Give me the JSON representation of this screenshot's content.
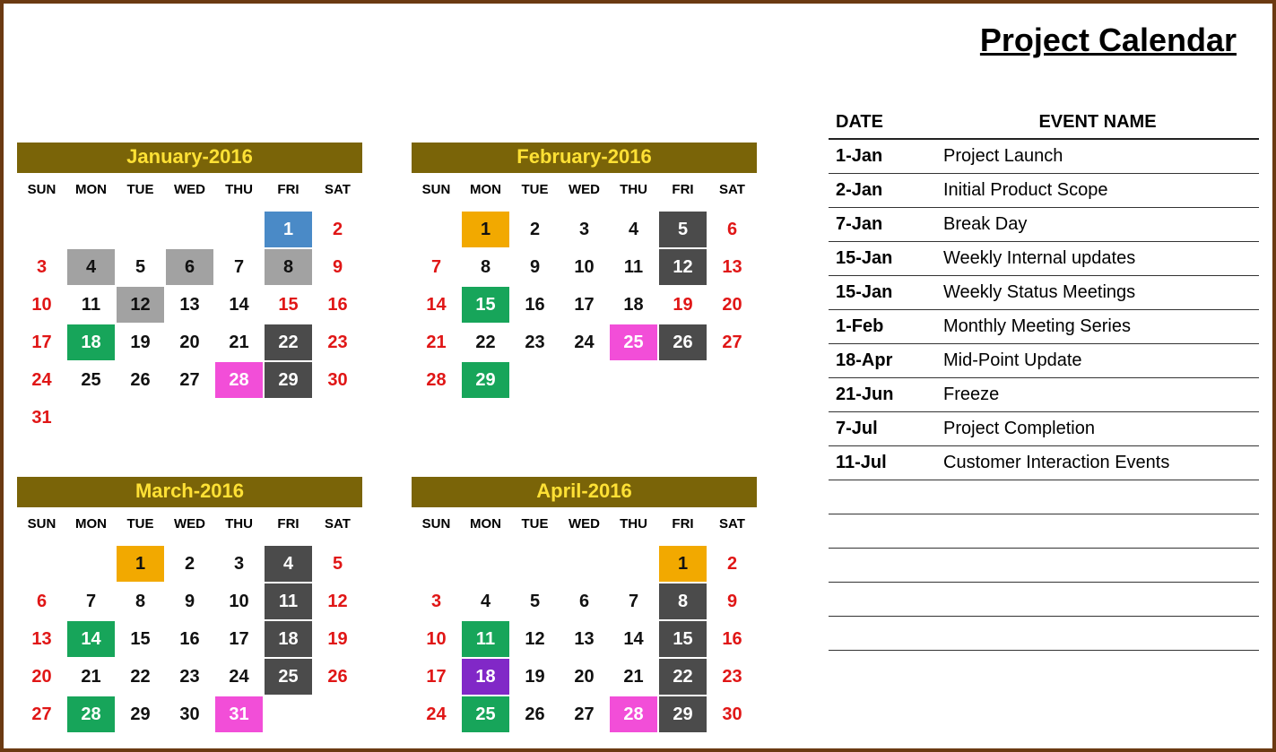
{
  "title": "Project Calendar",
  "dow": [
    "SUN",
    "MON",
    "TUE",
    "WED",
    "THU",
    "FRI",
    "SAT"
  ],
  "months": [
    {
      "title": "January-2016",
      "lead": 5,
      "days": [
        {
          "n": 1,
          "c": "hl-blue"
        },
        {
          "n": 2,
          "c": "weekend"
        },
        {
          "n": 3,
          "c": "weekend"
        },
        {
          "n": 4,
          "c": "hl-grey"
        },
        {
          "n": 5,
          "c": "normal"
        },
        {
          "n": 6,
          "c": "hl-grey"
        },
        {
          "n": 7,
          "c": "normal"
        },
        {
          "n": 8,
          "c": "hl-grey"
        },
        {
          "n": 9,
          "c": "weekend"
        },
        {
          "n": 10,
          "c": "weekend"
        },
        {
          "n": 11,
          "c": "normal"
        },
        {
          "n": 12,
          "c": "hl-grey"
        },
        {
          "n": 13,
          "c": "normal"
        },
        {
          "n": 14,
          "c": "normal"
        },
        {
          "n": 15,
          "c": "hl-redfriday"
        },
        {
          "n": 16,
          "c": "weekend"
        },
        {
          "n": 17,
          "c": "weekend"
        },
        {
          "n": 18,
          "c": "hl-green"
        },
        {
          "n": 19,
          "c": "normal"
        },
        {
          "n": 20,
          "c": "normal"
        },
        {
          "n": 21,
          "c": "normal"
        },
        {
          "n": 22,
          "c": "hl-dark"
        },
        {
          "n": 23,
          "c": "weekend"
        },
        {
          "n": 24,
          "c": "weekend"
        },
        {
          "n": 25,
          "c": "normal"
        },
        {
          "n": 26,
          "c": "normal"
        },
        {
          "n": 27,
          "c": "normal"
        },
        {
          "n": 28,
          "c": "hl-pink"
        },
        {
          "n": 29,
          "c": "hl-dark"
        },
        {
          "n": 30,
          "c": "weekend"
        },
        {
          "n": 31,
          "c": "weekend"
        }
      ]
    },
    {
      "title": "February-2016",
      "lead": 1,
      "days": [
        {
          "n": 1,
          "c": "hl-orange"
        },
        {
          "n": 2,
          "c": "normal"
        },
        {
          "n": 3,
          "c": "normal"
        },
        {
          "n": 4,
          "c": "normal"
        },
        {
          "n": 5,
          "c": "hl-dark"
        },
        {
          "n": 6,
          "c": "weekend"
        },
        {
          "n": 7,
          "c": "weekend"
        },
        {
          "n": 8,
          "c": "normal"
        },
        {
          "n": 9,
          "c": "normal"
        },
        {
          "n": 10,
          "c": "normal"
        },
        {
          "n": 11,
          "c": "normal"
        },
        {
          "n": 12,
          "c": "hl-dark"
        },
        {
          "n": 13,
          "c": "weekend"
        },
        {
          "n": 14,
          "c": "weekend"
        },
        {
          "n": 15,
          "c": "hl-green"
        },
        {
          "n": 16,
          "c": "normal"
        },
        {
          "n": 17,
          "c": "normal"
        },
        {
          "n": 18,
          "c": "normal"
        },
        {
          "n": 19,
          "c": "hl-redfriday"
        },
        {
          "n": 20,
          "c": "weekend"
        },
        {
          "n": 21,
          "c": "weekend"
        },
        {
          "n": 22,
          "c": "normal"
        },
        {
          "n": 23,
          "c": "normal"
        },
        {
          "n": 24,
          "c": "normal"
        },
        {
          "n": 25,
          "c": "hl-pink"
        },
        {
          "n": 26,
          "c": "hl-dark"
        },
        {
          "n": 27,
          "c": "weekend"
        },
        {
          "n": 28,
          "c": "weekend"
        },
        {
          "n": 29,
          "c": "hl-green"
        }
      ]
    },
    {
      "title": "March-2016",
      "lead": 2,
      "days": [
        {
          "n": 1,
          "c": "hl-orange"
        },
        {
          "n": 2,
          "c": "normal"
        },
        {
          "n": 3,
          "c": "normal"
        },
        {
          "n": 4,
          "c": "hl-dark"
        },
        {
          "n": 5,
          "c": "weekend"
        },
        {
          "n": 6,
          "c": "weekend"
        },
        {
          "n": 7,
          "c": "normal"
        },
        {
          "n": 8,
          "c": "normal"
        },
        {
          "n": 9,
          "c": "normal"
        },
        {
          "n": 10,
          "c": "normal"
        },
        {
          "n": 11,
          "c": "hl-dark"
        },
        {
          "n": 12,
          "c": "weekend"
        },
        {
          "n": 13,
          "c": "weekend"
        },
        {
          "n": 14,
          "c": "hl-green"
        },
        {
          "n": 15,
          "c": "normal"
        },
        {
          "n": 16,
          "c": "normal"
        },
        {
          "n": 17,
          "c": "normal"
        },
        {
          "n": 18,
          "c": "hl-dark"
        },
        {
          "n": 19,
          "c": "weekend"
        },
        {
          "n": 20,
          "c": "weekend"
        },
        {
          "n": 21,
          "c": "normal"
        },
        {
          "n": 22,
          "c": "normal"
        },
        {
          "n": 23,
          "c": "normal"
        },
        {
          "n": 24,
          "c": "normal"
        },
        {
          "n": 25,
          "c": "hl-dark"
        },
        {
          "n": 26,
          "c": "weekend"
        },
        {
          "n": 27,
          "c": "weekend"
        },
        {
          "n": 28,
          "c": "hl-green"
        },
        {
          "n": 29,
          "c": "normal"
        },
        {
          "n": 30,
          "c": "normal"
        },
        {
          "n": 31,
          "c": "hl-pink"
        }
      ]
    },
    {
      "title": "April-2016",
      "lead": 5,
      "days": [
        {
          "n": 1,
          "c": "hl-orange"
        },
        {
          "n": 2,
          "c": "weekend"
        },
        {
          "n": 3,
          "c": "weekend"
        },
        {
          "n": 4,
          "c": "normal"
        },
        {
          "n": 5,
          "c": "normal"
        },
        {
          "n": 6,
          "c": "normal"
        },
        {
          "n": 7,
          "c": "normal"
        },
        {
          "n": 8,
          "c": "hl-dark"
        },
        {
          "n": 9,
          "c": "weekend"
        },
        {
          "n": 10,
          "c": "weekend"
        },
        {
          "n": 11,
          "c": "hl-green"
        },
        {
          "n": 12,
          "c": "normal"
        },
        {
          "n": 13,
          "c": "normal"
        },
        {
          "n": 14,
          "c": "normal"
        },
        {
          "n": 15,
          "c": "hl-dark"
        },
        {
          "n": 16,
          "c": "weekend"
        },
        {
          "n": 17,
          "c": "weekend"
        },
        {
          "n": 18,
          "c": "hl-purple"
        },
        {
          "n": 19,
          "c": "normal"
        },
        {
          "n": 20,
          "c": "normal"
        },
        {
          "n": 21,
          "c": "normal"
        },
        {
          "n": 22,
          "c": "hl-dark"
        },
        {
          "n": 23,
          "c": "weekend"
        },
        {
          "n": 24,
          "c": "weekend"
        },
        {
          "n": 25,
          "c": "hl-green"
        },
        {
          "n": 26,
          "c": "normal"
        },
        {
          "n": 27,
          "c": "normal"
        },
        {
          "n": 28,
          "c": "hl-pink"
        },
        {
          "n": 29,
          "c": "hl-dark"
        },
        {
          "n": 30,
          "c": "weekend"
        }
      ]
    }
  ],
  "events_header": {
    "date": "DATE",
    "name": "EVENT NAME"
  },
  "events": [
    {
      "date": "1-Jan",
      "name": "Project Launch"
    },
    {
      "date": "2-Jan",
      "name": "Initial Product Scope"
    },
    {
      "date": "7-Jan",
      "name": "Break Day"
    },
    {
      "date": "15-Jan",
      "name": "Weekly Internal updates"
    },
    {
      "date": "15-Jan",
      "name": "Weekly Status Meetings"
    },
    {
      "date": "1-Feb",
      "name": "Monthly Meeting Series"
    },
    {
      "date": "18-Apr",
      "name": "Mid-Point Update"
    },
    {
      "date": "21-Jun",
      "name": "Freeze"
    },
    {
      "date": "7-Jul",
      "name": "Project Completion"
    },
    {
      "date": "11-Jul",
      "name": "Customer Interaction Events"
    }
  ],
  "blank_rows": 5
}
